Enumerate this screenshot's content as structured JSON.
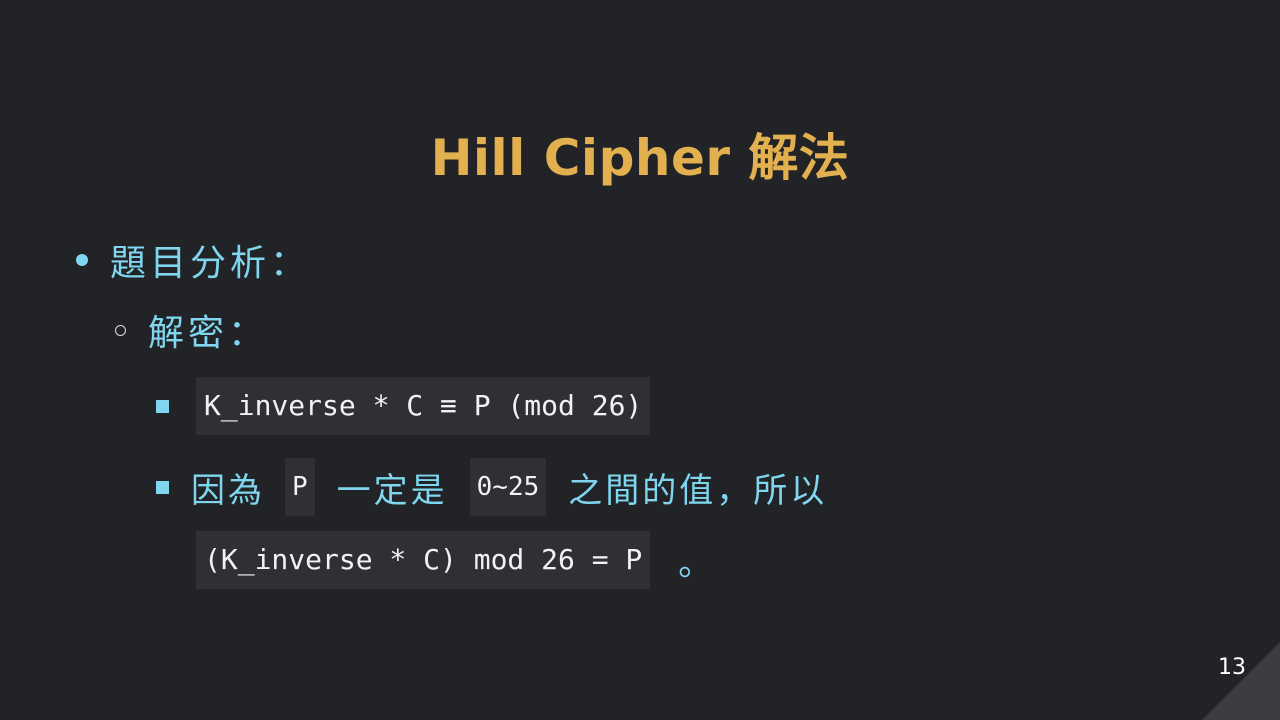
{
  "slide": {
    "title": "Hill Cipher 解法",
    "bullet1": {
      "text": "題目分析："
    },
    "bullet2": {
      "text": "解密："
    },
    "bullet3": {
      "code": "K_inverse * C ≡ P (mod 26)"
    },
    "bullet4": {
      "text_a": "因為",
      "code_a": "P",
      "text_b": "一定是",
      "code_b": "0~25",
      "text_c": "之間的值，所以",
      "code_c": "(K_inverse * C) mod 26 = P",
      "text_d": "。"
    },
    "page_number": "13"
  },
  "colors": {
    "background": "#222327",
    "title": "#e2b04f",
    "body_text": "#7fd6ee",
    "code_bg": "#2f3035",
    "code_text": "#f2f2f2"
  }
}
